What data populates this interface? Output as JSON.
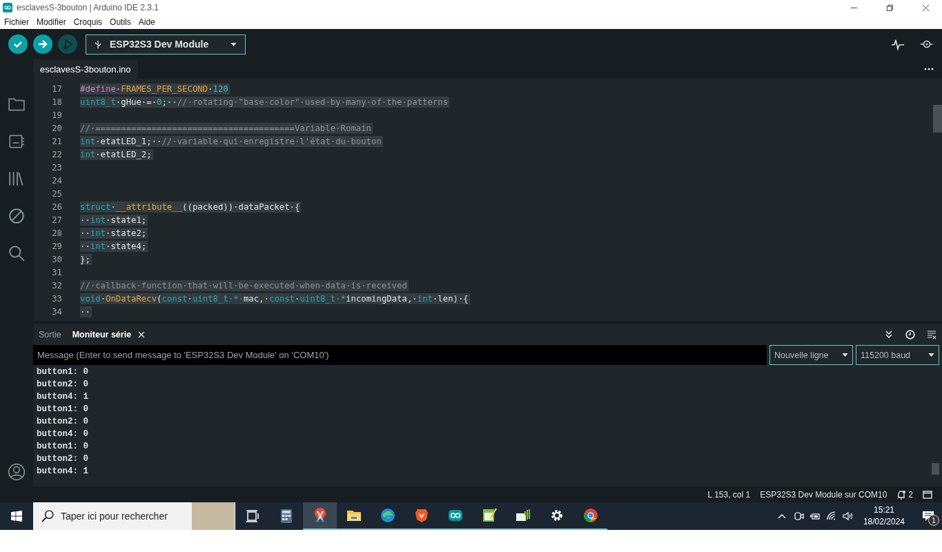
{
  "window": {
    "title": "esclavesS-3bouton | Arduino IDE 2.3.1"
  },
  "menu": [
    "Fichier",
    "Modifier",
    "Croquis",
    "Outils",
    "Aide"
  ],
  "toolbar": {
    "buttons": [
      {
        "kind": "verify",
        "disabled": false
      },
      {
        "kind": "upload",
        "disabled": false
      },
      {
        "kind": "debug",
        "disabled": true
      }
    ],
    "board": "ESP32S3 Dev Module"
  },
  "sidebar": {
    "items": [
      {
        "kind": "folder",
        "selected": false
      },
      {
        "kind": "board",
        "selected": false
      },
      {
        "kind": "library",
        "selected": false
      },
      {
        "kind": "debug",
        "selected": false
      },
      {
        "kind": "search",
        "selected": false
      }
    ]
  },
  "editor_tabs": [
    {
      "label": "esclavesS-3bouton.ino",
      "selected": true
    }
  ],
  "code": [
    {
      "n": "17",
      "tokens": [
        {
          "kind": "macro",
          "text": "#define"
        },
        {
          "kind": "txt",
          "text": "·"
        },
        {
          "kind": "fn",
          "text": "FRAMES_PER_SECOND"
        },
        {
          "kind": "txt",
          "text": "·"
        },
        {
          "kind": "num",
          "text": "120"
        }
      ]
    },
    {
      "n": "18",
      "tokens": [
        {
          "kind": "kw",
          "text": "uint8_t"
        },
        {
          "kind": "txt",
          "text": "·gHue·=·"
        },
        {
          "kind": "num",
          "text": "0"
        },
        {
          "kind": "txt",
          "text": ";··"
        },
        {
          "kind": "cmt",
          "text": "//·rotating·\"base·color\"·used·by·many·of·the·patterns"
        }
      ]
    },
    {
      "n": "19"
    },
    {
      "n": "20",
      "tokens": [
        {
          "kind": "cmt",
          "text": "//·=======================================Variable·Romain"
        }
      ]
    },
    {
      "n": "21",
      "tokens": [
        {
          "kind": "kw",
          "text": "int"
        },
        {
          "kind": "txt",
          "text": "·etatLED_1;··"
        },
        {
          "kind": "cmt",
          "text": "//·variable·qui·enregistre·l'état·du·bouton"
        }
      ]
    },
    {
      "n": "22",
      "tokens": [
        {
          "kind": "kw",
          "text": "int"
        },
        {
          "kind": "txt",
          "text": "·etatLED_2;"
        }
      ]
    },
    {
      "n": "23"
    },
    {
      "n": "24"
    },
    {
      "n": "25"
    },
    {
      "n": "26",
      "tokens": [
        {
          "kind": "kw",
          "text": "struct"
        },
        {
          "kind": "txt",
          "text": "·"
        },
        {
          "kind": "fn",
          "text": "__attribute__"
        },
        {
          "kind": "txt",
          "text": "((packed))·dataPacket·{"
        }
      ]
    },
    {
      "n": "27",
      "tokens": [
        {
          "kind": "txt",
          "text": "··"
        },
        {
          "kind": "kw",
          "text": "int"
        },
        {
          "kind": "txt",
          "text": "·state1;"
        }
      ]
    },
    {
      "n": "28",
      "tokens": [
        {
          "kind": "txt",
          "text": "··"
        },
        {
          "kind": "kw",
          "text": "int"
        },
        {
          "kind": "txt",
          "text": "·state2;"
        }
      ]
    },
    {
      "n": "29",
      "tokens": [
        {
          "kind": "txt",
          "text": "··"
        },
        {
          "kind": "kw",
          "text": "int"
        },
        {
          "kind": "txt",
          "text": "·state4;"
        }
      ]
    },
    {
      "n": "30",
      "tokens": [
        {
          "kind": "txt",
          "text": "};"
        }
      ]
    },
    {
      "n": "31"
    },
    {
      "n": "32",
      "tokens": [
        {
          "kind": "cmt",
          "text": "//·callback·function·that·will·be·executed·when·data·is·received"
        }
      ]
    },
    {
      "n": "33",
      "tokens": [
        {
          "kind": "kw",
          "text": "void"
        },
        {
          "kind": "txt",
          "text": "·"
        },
        {
          "kind": "fn",
          "text": "OnDataRecv"
        },
        {
          "kind": "txt",
          "text": "("
        },
        {
          "kind": "kw",
          "text": "const"
        },
        {
          "kind": "txt",
          "text": "·"
        },
        {
          "kind": "kw",
          "text": "uint8_t"
        },
        {
          "kind": "kw",
          "text": "·*·"
        },
        {
          "kind": "txt",
          "text": "mac,·"
        },
        {
          "kind": "kw",
          "text": "const"
        },
        {
          "kind": "txt",
          "text": "·"
        },
        {
          "kind": "kw",
          "text": "uint8_t"
        },
        {
          "kind": "kw",
          "text": "·*"
        },
        {
          "kind": "txt",
          "text": "incomingData,·"
        },
        {
          "kind": "kw",
          "text": "int"
        },
        {
          "kind": "txt",
          "text": "·len)·{"
        }
      ]
    },
    {
      "n": "34",
      "tokens": [
        {
          "kind": "txt",
          "text": "··"
        }
      ]
    }
  ],
  "panel": {
    "tabs": [
      {
        "label": "Sortie",
        "selected": false,
        "closable": false
      },
      {
        "label": "Moniteur série",
        "selected": true,
        "closable": true
      }
    ],
    "message": {
      "placeholder": "Message (Enter to send message to 'ESP32S3 Dev Module' on 'COM10')"
    },
    "line_ending": "Nouvelle ligne",
    "baud": "115200 baud",
    "output": [
      "button1: 0",
      "button2: 0",
      "button4: 1",
      "button1: 0",
      "button2: 0",
      "button4: 0",
      "button1: 0",
      "button2: 0",
      "button4: 1"
    ]
  },
  "status_bar": {
    "position": "L 153, col 1",
    "board": "ESP32S3 Dev Module sur COM10",
    "notifications": "2"
  },
  "taskbar": {
    "search": {
      "placeholder": "Taper ici pour rechercher"
    },
    "apps": [
      {
        "kind": "taskview",
        "running": false,
        "active": false
      },
      {
        "kind": "calculator",
        "running": false,
        "active": false
      },
      {
        "kind": "snip",
        "running": true,
        "active": true
      },
      {
        "kind": "folder",
        "running": true,
        "active": false
      },
      {
        "kind": "edge",
        "running": true,
        "active": false
      },
      {
        "kind": "brave",
        "running": true,
        "active": false
      },
      {
        "kind": "arduino",
        "running": true,
        "active": false
      },
      {
        "kind": "notepad",
        "running": true,
        "active": false
      },
      {
        "kind": "spacedesk",
        "running": true,
        "active": false
      },
      {
        "kind": "settings",
        "running": true,
        "active": false
      },
      {
        "kind": "chrome",
        "running": true,
        "active": false
      }
    ],
    "time": "15:21",
    "date": "18/02/2024",
    "notification_count": "1"
  }
}
